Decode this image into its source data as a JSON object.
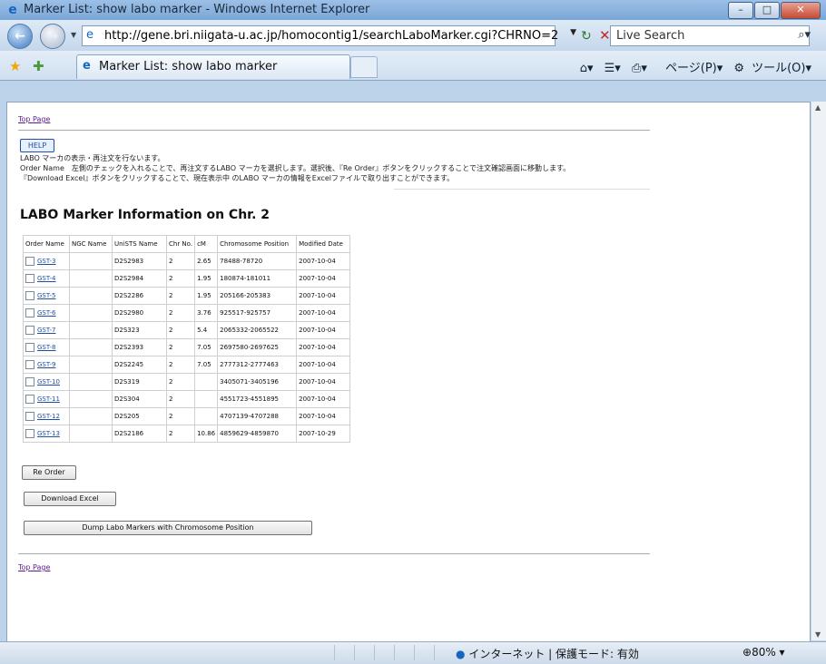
{
  "window": {
    "title": "Marker List: show labo marker - Windows Internet Explorer"
  },
  "addressbar": {
    "url": "http://gene.bri.niigata-u.ac.jp/homocontig1/searchLaboMarker.cgi?CHRNO=2",
    "search_placeholder": "Live Search"
  },
  "tab": {
    "label": "Marker List: show labo marker"
  },
  "toolbar": {
    "page_menu": "ページ(P)",
    "tools_menu": "ツール(O)"
  },
  "page": {
    "top_link": "Top Page",
    "help_button": "HELP",
    "help_lines": [
      "LABO マーカの表示・再注文を行ないます。",
      "Order Name　左側のチェックを入れることで、再注文するLABO マーカを選択します。選択後、『Re Order』ボタンをクリックすることで注文確認画面に移動します。",
      "『Download Excel』ボタンをクリックすることで、現在表示中 のLABO マーカの情報をExcelファイルで取り出すことができます。"
    ],
    "heading": "LABO Marker Information on Chr. 2",
    "columns": [
      "Order Name",
      "NGC Name",
      "UniSTS Name",
      "Chr No.",
      "cM",
      "Chromosome Position",
      "Modified Date"
    ],
    "rows": [
      {
        "order": "GST-3",
        "ngc": "",
        "unists": "D2S2983",
        "chr": "2",
        "cm": "2.65",
        "pos": "78488-78720",
        "date": "2007-10-04"
      },
      {
        "order": "GST-4",
        "ngc": "",
        "unists": "D2S2984",
        "chr": "2",
        "cm": "1.95",
        "pos": "180874-181011",
        "date": "2007-10-04"
      },
      {
        "order": "GST-5",
        "ngc": "",
        "unists": "D2S2286",
        "chr": "2",
        "cm": "1.95",
        "pos": "205166-205383",
        "date": "2007-10-04"
      },
      {
        "order": "GST-6",
        "ngc": "",
        "unists": "D2S2980",
        "chr": "2",
        "cm": "3.76",
        "pos": "925517-925757",
        "date": "2007-10-04"
      },
      {
        "order": "GST-7",
        "ngc": "",
        "unists": "D2S323",
        "chr": "2",
        "cm": "5.4",
        "pos": "2065332-2065522",
        "date": "2007-10-04"
      },
      {
        "order": "GST-8",
        "ngc": "",
        "unists": "D2S2393",
        "chr": "2",
        "cm": "7.05",
        "pos": "2697580-2697625",
        "date": "2007-10-04"
      },
      {
        "order": "GST-9",
        "ngc": "",
        "unists": "D2S2245",
        "chr": "2",
        "cm": "7.05",
        "pos": "2777312-2777463",
        "date": "2007-10-04"
      },
      {
        "order": "GST-10",
        "ngc": "",
        "unists": "D2S319",
        "chr": "2",
        "cm": "",
        "pos": "3405071-3405196",
        "date": "2007-10-04"
      },
      {
        "order": "GST-11",
        "ngc": "",
        "unists": "D2S304",
        "chr": "2",
        "cm": "",
        "pos": "4551723-4551895",
        "date": "2007-10-04"
      },
      {
        "order": "GST-12",
        "ngc": "",
        "unists": "D2S205",
        "chr": "2",
        "cm": "",
        "pos": "4707139-4707288",
        "date": "2007-10-04"
      },
      {
        "order": "GST-13",
        "ngc": "",
        "unists": "D2S2186",
        "chr": "2",
        "cm": "10.86",
        "pos": "4859629-4859870",
        "date": "2007-10-29"
      }
    ],
    "reorder_button": "Re Order",
    "download_button": "Download Excel",
    "dump_button": "Dump Labo Markers with Chromosome Position"
  },
  "status": {
    "zone": "インターネット | 保護モード: 有効",
    "zoom": "80%"
  }
}
